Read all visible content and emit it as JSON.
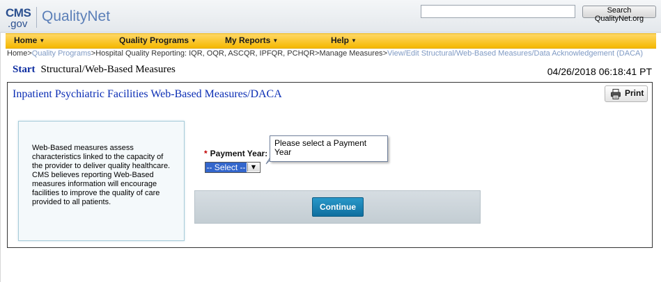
{
  "header": {
    "logo_cms": "CMS",
    "logo_gov": ".gov",
    "logo_name": "QualityNet",
    "search_value": "",
    "search_button": "Search QualityNet.org"
  },
  "nav": {
    "items": [
      {
        "label": "Home"
      },
      {
        "label": "Quality Programs"
      },
      {
        "label": "My Reports"
      },
      {
        "label": "Help"
      }
    ]
  },
  "breadcrumb": {
    "home": "Home",
    "sep": ">",
    "quality_programs": "Quality Programs",
    "hospital": "Hospital Quality Reporting: IQR, OQR, ASCQR, IPFQR, PCHQR",
    "manage": "Manage Measures",
    "current": "View/Edit Structural/Web-Based Measures/Data Acknowledgement (DACA)"
  },
  "page": {
    "start": "Start",
    "title": "Structural/Web-Based Measures",
    "datetime": "04/26/2018 06:18:41 PT"
  },
  "panel": {
    "title": "Inpatient Psychiatric Facilities Web-Based Measures/DACA",
    "print_label": "Print",
    "info": "Web-Based measures assess characteristics linked to the capacity of the provider to deliver quality healthcare. CMS believes reporting Web-Based measures information will encourage facilities to improve the quality of care provided to all patients.",
    "field_required": "*",
    "field_label": "Payment Year:",
    "select_value": "-- Select --",
    "tooltip": "Please select a Payment Year",
    "continue_label": "Continue"
  },
  "colors": {
    "nav_bg": "#f5b800",
    "title_blue": "#0a2db4",
    "continue_bg": "#0f6f9f",
    "select_highlight": "#3366cc",
    "required": "#c00000"
  }
}
